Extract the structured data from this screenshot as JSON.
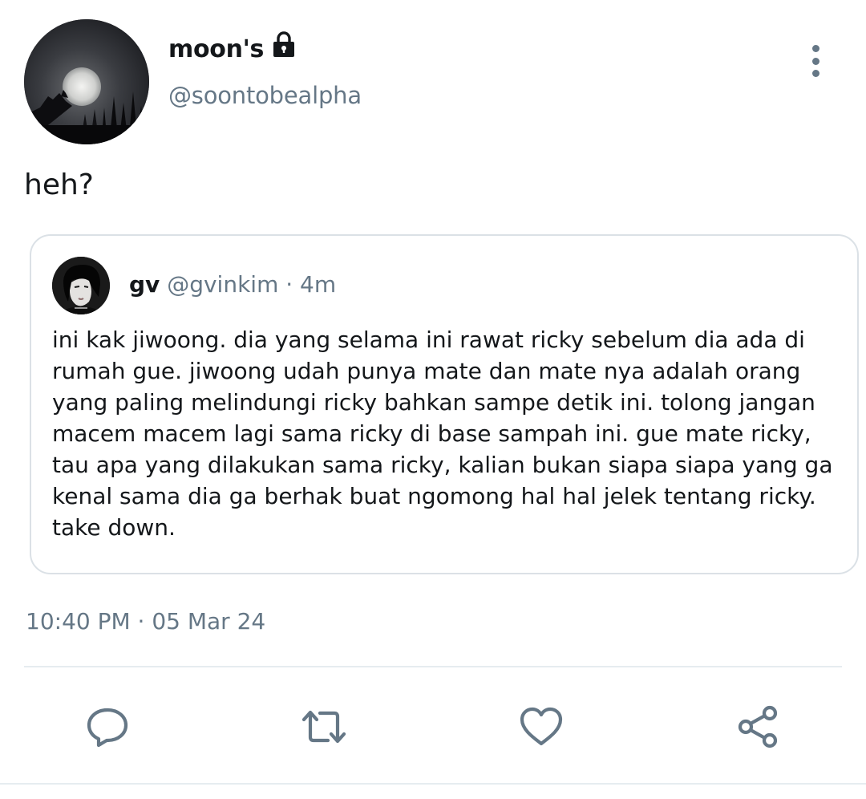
{
  "tweet": {
    "display_name": "moon's",
    "username": "@soontobealpha",
    "text": "heh?",
    "timestamp": "10:40 PM · 05 Mar 24"
  },
  "quoted_tweet": {
    "display_name": "gv",
    "meta": "@gvinkim · 4m",
    "lines": [
      "ini kak jiwoong. dia yang selama ini rawat ricky sebelum dia ada di",
      "rumah gue. jiwoong udah punya mate dan mate nya adalah orang",
      "yang paling melindungi ricky bahkan sampe detik ini. tolong jangan",
      "macem macem lagi sama ricky di base sampah ini. gue mate ricky,",
      "tau apa yang dilakukan sama ricky, kalian bukan siapa siapa yang ga",
      "kenal sama dia ga berhak buat ngomong hal hal jelek tentang ricky.",
      "take down."
    ]
  },
  "icons": {
    "lock": "lock-icon",
    "more": "more-vertical-icon",
    "reply": "reply-icon",
    "retweet": "retweet-icon",
    "like": "heart-icon",
    "share": "share-icon"
  },
  "colors": {
    "text": "#14171a",
    "secondary": "#657786",
    "border": "#dbe1e6"
  }
}
